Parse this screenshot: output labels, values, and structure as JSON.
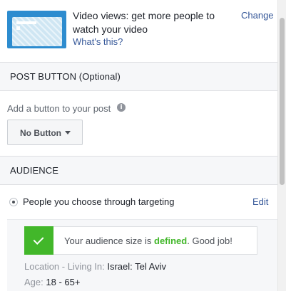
{
  "objective": {
    "description": "Video views: get more people to watch your video",
    "link": "What's this?",
    "change_label": "Change"
  },
  "post_button_section": {
    "header": "POST BUTTON (Optional)",
    "add_label": "Add a button to your post",
    "info_icon": "info-icon",
    "dropdown_value": "No Button"
  },
  "audience_section": {
    "header": "AUDIENCE",
    "option_label": "People you choose through targeting",
    "edit_label": "Edit",
    "notice": {
      "prefix": "Your audience size is ",
      "status": "defined",
      "suffix": ". Good job!"
    },
    "location_label": "Location - Living In:",
    "location_value": "Israel: Tel Aviv",
    "age_label": "Age:",
    "age_value": "18 - 65+"
  },
  "colors": {
    "link": "#365899",
    "success": "#42b72a",
    "section_bg": "#f6f7f9"
  }
}
